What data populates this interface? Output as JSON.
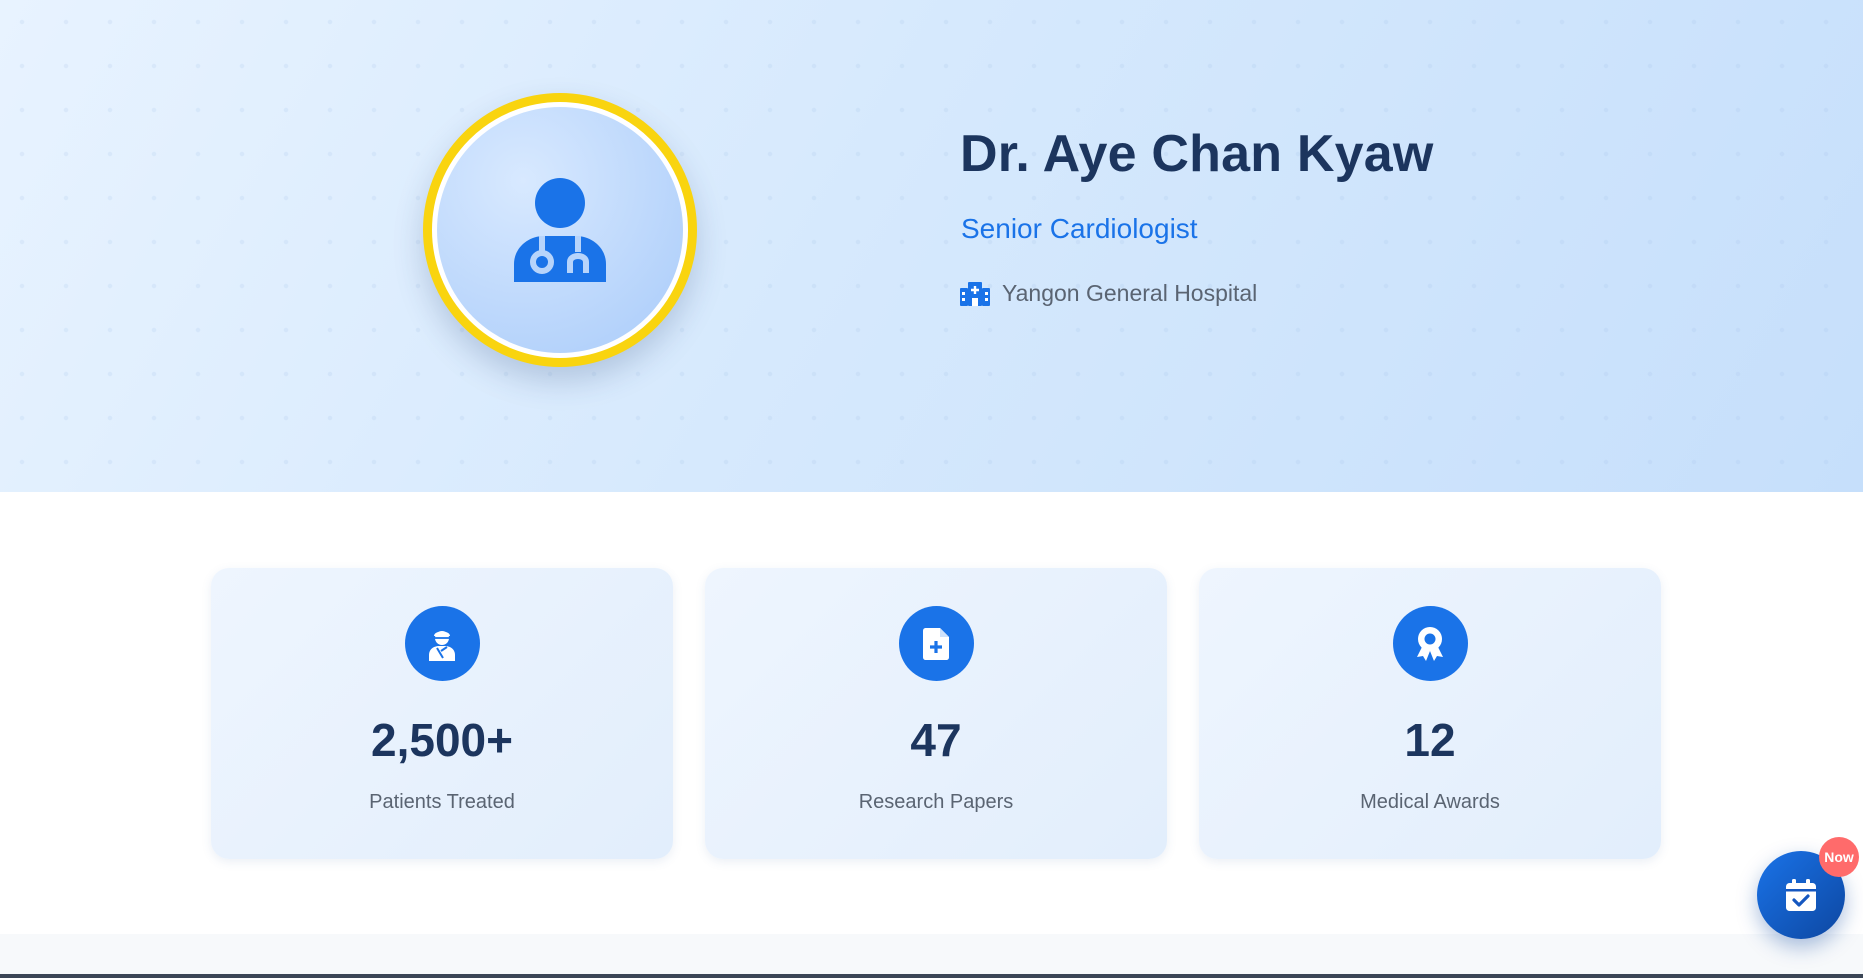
{
  "profile": {
    "name": "Dr. Aye Chan Kyaw",
    "title": "Senior Cardiologist",
    "hospital": "Yangon General Hospital",
    "avatar_icon": "doctor-icon",
    "hospital_icon": "hospital-icon"
  },
  "stats": [
    {
      "value": "2,500+",
      "label": "Patients Treated",
      "icon": "patient-icon"
    },
    {
      "value": "47",
      "label": "Research Papers",
      "icon": "medical-file-icon"
    },
    {
      "value": "12",
      "label": "Medical Awards",
      "icon": "award-icon"
    }
  ],
  "fab": {
    "icon": "calendar-check-icon",
    "badge": "Now"
  },
  "colors": {
    "accent": "#1a73e8",
    "heading": "#1c355e",
    "ring": "#f9d40f",
    "badge": "#ff6b6b"
  }
}
